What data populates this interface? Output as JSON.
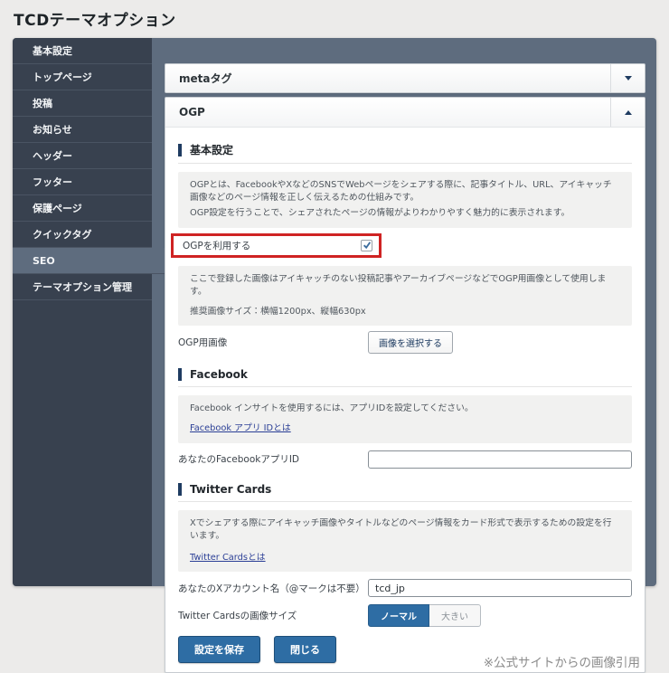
{
  "page": {
    "title": "TCDテーマオプション",
    "footnote": "※公式サイトからの画像引用"
  },
  "colors": {
    "sidebar_bg": "#38414f",
    "panel_backdrop": "#5e6c7e",
    "accent_blue": "#2e6da4",
    "heading_bar_navy": "#1f3c61",
    "annotation_red": "#cf2323",
    "link_blue": "#2b3f96",
    "info_box_gray": "#f1f1f0"
  },
  "sidebar": {
    "items": [
      {
        "label": "基本設定",
        "active": false
      },
      {
        "label": "トップページ",
        "active": false
      },
      {
        "label": "投稿",
        "active": false
      },
      {
        "label": "お知らせ",
        "active": false
      },
      {
        "label": "ヘッダー",
        "active": false
      },
      {
        "label": "フッター",
        "active": false
      },
      {
        "label": "保護ページ",
        "active": false
      },
      {
        "label": "クイックタグ",
        "active": false
      },
      {
        "label": "SEO",
        "active": true
      },
      {
        "label": "テーマオプション管理",
        "active": false
      }
    ]
  },
  "accordion": {
    "meta": {
      "label": "metaタグ",
      "state": "collapsed"
    },
    "ogp": {
      "label": "OGP",
      "state": "expanded"
    }
  },
  "ogp": {
    "basic": {
      "heading": "基本設定",
      "description_line1": "OGPとは、FacebookやXなどのSNSでWebページをシェアする際に、記事タイトル、URL、アイキャッチ画像などのページ情報を正しく伝えるための仕組みです。",
      "description_line2": "OGP設定を行うことで、シェアされたページの情報がよりわかりやすく魅力的に表示されます。",
      "use_ogp_label": "OGPを利用する",
      "use_ogp_checked": true,
      "image_note_line1": "ここで登録した画像はアイキャッチのない投稿記事やアーカイブページなどでOGP用画像として使用します。",
      "image_note_line2": "推奨画像サイズ：横幅1200px、縦幅630px",
      "ogp_image_label": "OGP用画像",
      "select_image_button": "画像を選択する"
    },
    "facebook": {
      "heading": "Facebook",
      "description": "Facebook インサイトを使用するには、アプリIDを設定してください。",
      "link": "Facebook アプリ IDとは",
      "app_id_label": "あなたのFacebookアプリID",
      "app_id_value": ""
    },
    "twitter": {
      "heading": "Twitter Cards",
      "description": "Xでシェアする際にアイキャッチ画像やタイトルなどのページ情報をカード形式で表示するための設定を行います。",
      "link": "Twitter Cardsとは",
      "account_label": "あなたのXアカウント名（@マークは不要）",
      "account_value": "tcd_jp",
      "image_size_label": "Twitter Cardsの画像サイズ",
      "size_options": [
        {
          "label": "ノーマル",
          "selected": true
        },
        {
          "label": "大きい",
          "selected": false
        }
      ]
    },
    "actions": {
      "save_button": "設定を保存",
      "close_button": "閉じる"
    }
  }
}
